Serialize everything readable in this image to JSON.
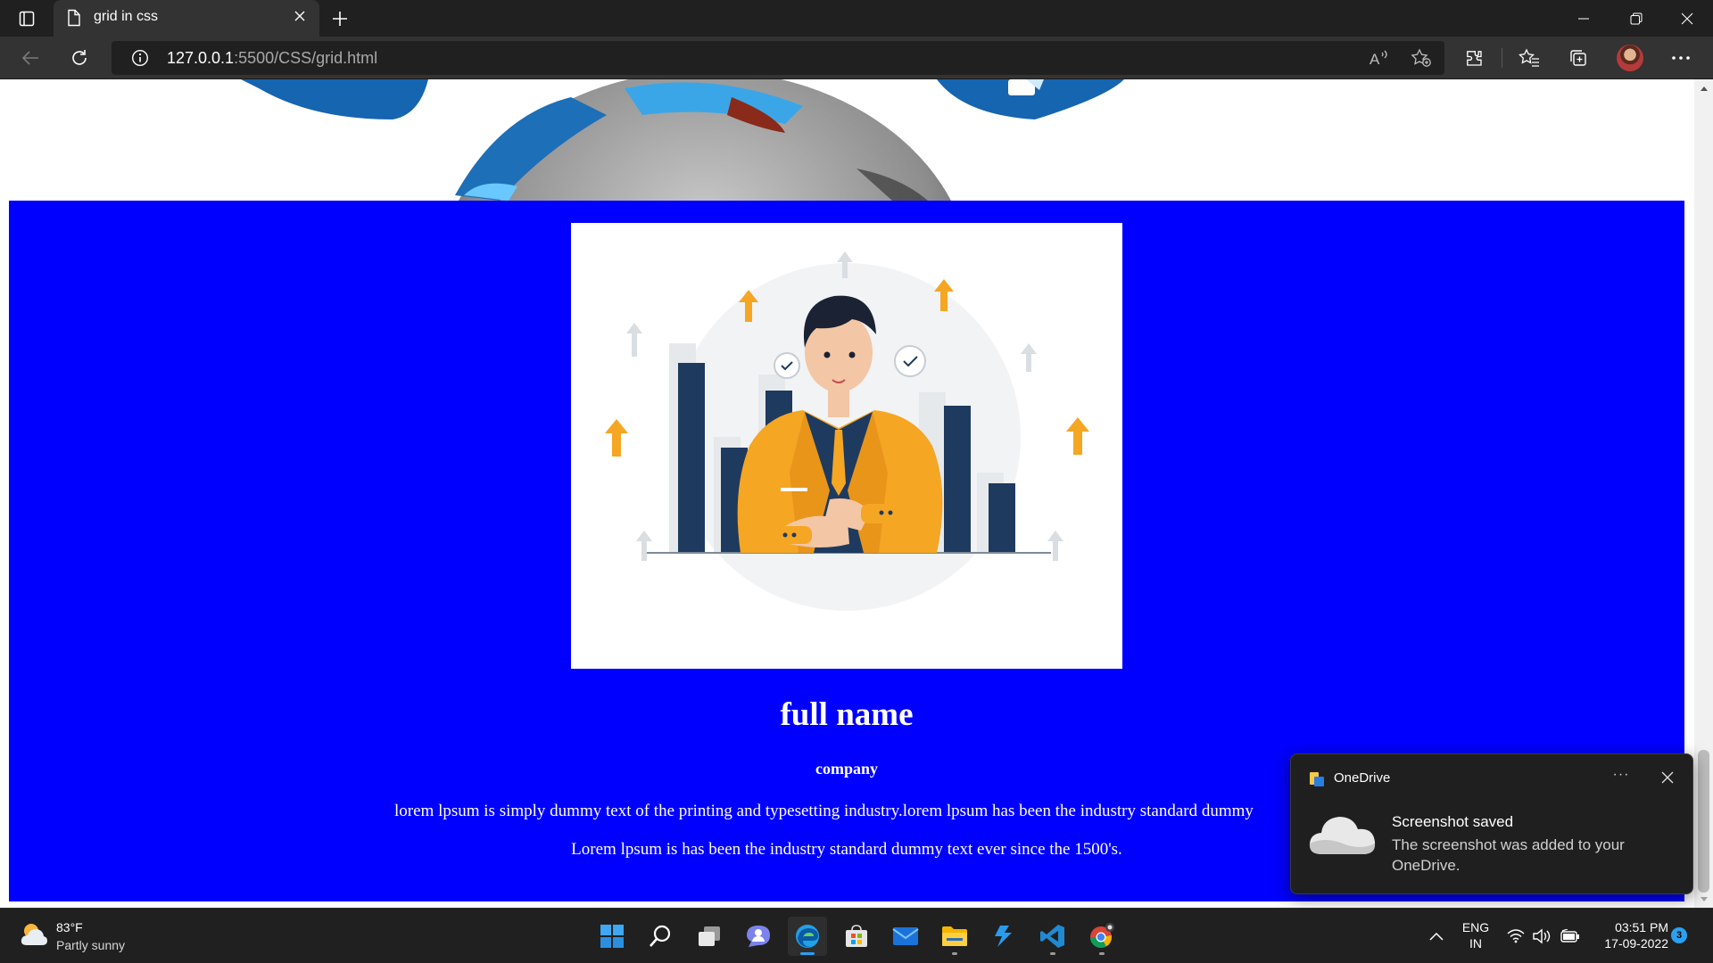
{
  "browser": {
    "tab_title": "grid in css",
    "url_host": "127.0.0.1",
    "url_path": ":5500/CSS/grid.html"
  },
  "page": {
    "name": "full name",
    "company": "company",
    "paragraph1": "lorem lpsum is simply dummy text of the printing and typesetting industry.lorem lpsum has been the industry standard dummy",
    "paragraph2": "Lorem lpsum is has been the industry standard dummy text ever since the 1500's.",
    "card_color": "#0000ff"
  },
  "toast": {
    "app": "OneDrive",
    "more": "···",
    "title": "Screenshot saved",
    "body": "The screenshot was added to your OneDrive."
  },
  "taskbar": {
    "weather_temp": "83°F",
    "weather_condition": "Partly sunny",
    "lang_line1": "ENG",
    "lang_line2": "IN",
    "time": "03:51 PM",
    "date": "17-09-2022",
    "notification_count": "3",
    "apps": [
      "start-icon",
      "search-icon",
      "task-view-icon",
      "chat-icon",
      "edge-icon",
      "store-icon",
      "mail-icon",
      "file-explorer-icon",
      "vs-code-insiders-icon",
      "vs-code-icon",
      "chrome-icon"
    ]
  },
  "accent_colors": {
    "taskbar_indicator": "#2aa0f0",
    "edge": "#1fa2e8"
  }
}
